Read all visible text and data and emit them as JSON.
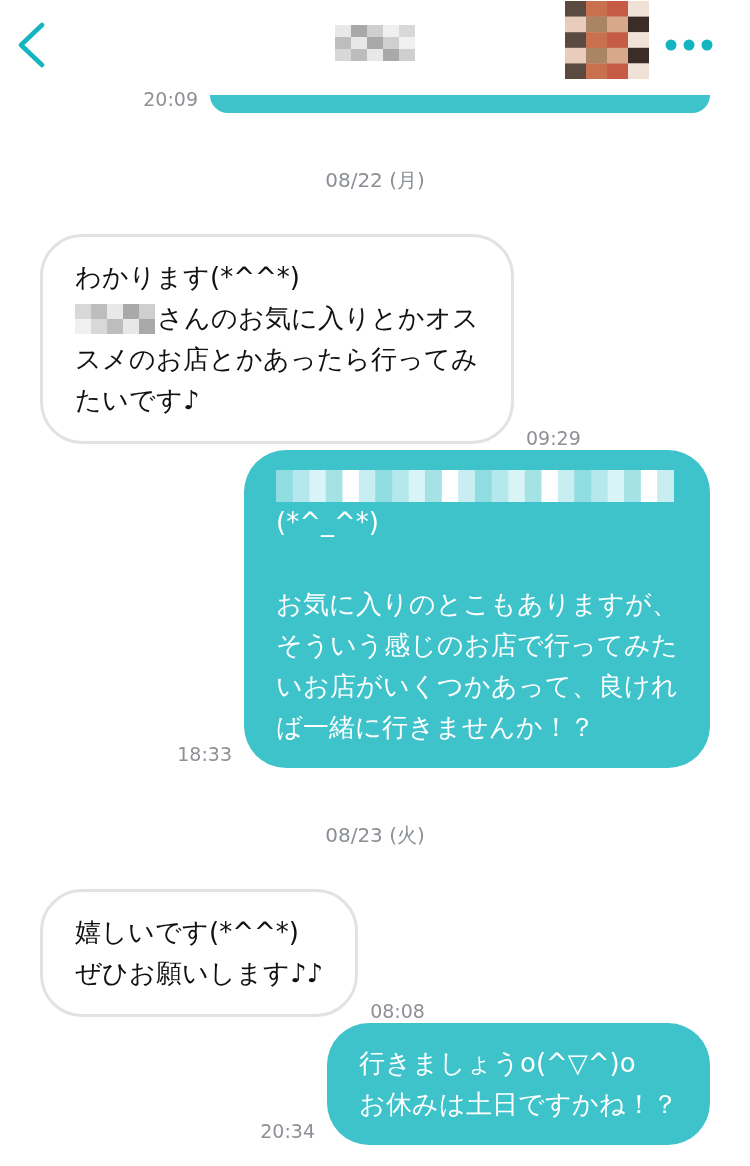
{
  "timeline": [
    {
      "kind": "message",
      "outgoing": true,
      "partial": true,
      "time": "20:09"
    },
    {
      "kind": "date",
      "text": "08/22 (月)"
    },
    {
      "kind": "message",
      "outgoing": false,
      "partial": false,
      "time": "09:29",
      "paragraphs": [
        [
          [
            {
              "kind": "text",
              "text": "わかります(*^^*)"
            }
          ],
          [
            {
              "kind": "redacted-name"
            },
            {
              "kind": "text",
              "text": "さんのお気に入りとかオス"
            }
          ],
          [
            {
              "kind": "text",
              "text": "スメのお店とかあったら行ってみ"
            }
          ],
          [
            {
              "kind": "text",
              "text": "たいです♪"
            }
          ]
        ]
      ]
    },
    {
      "kind": "message",
      "outgoing": true,
      "partial": false,
      "time": "18:33",
      "paragraphs": [
        [
          [
            {
              "kind": "redacted-line"
            }
          ],
          [
            {
              "kind": "text",
              "text": "(*^_^*)"
            }
          ]
        ],
        [
          [
            {
              "kind": "text",
              "text": "お気に入りのとこもありますが、"
            }
          ],
          [
            {
              "kind": "text",
              "text": "そういう感じのお店で行ってみた"
            }
          ],
          [
            {
              "kind": "text",
              "text": "いお店がいくつかあって、良けれ"
            }
          ],
          [
            {
              "kind": "text",
              "text": "ば一緒に行きませんか！？"
            }
          ]
        ]
      ]
    },
    {
      "kind": "date",
      "text": "08/23 (火)"
    },
    {
      "kind": "message",
      "outgoing": false,
      "partial": false,
      "time": "08:08",
      "paragraphs": [
        [
          [
            {
              "kind": "text",
              "text": "嬉しいです(*^^*)"
            }
          ],
          [
            {
              "kind": "text",
              "text": "ぜひお願いします♪♪"
            }
          ]
        ]
      ]
    },
    {
      "kind": "message",
      "outgoing": true,
      "partial": false,
      "time": "20:34",
      "paragraphs": [
        [
          [
            {
              "kind": "text",
              "text": "行きましょうo(^▽^)o"
            }
          ],
          [
            {
              "kind": "text",
              "text": "お休みは土日ですかね！？"
            }
          ]
        ]
      ]
    }
  ]
}
